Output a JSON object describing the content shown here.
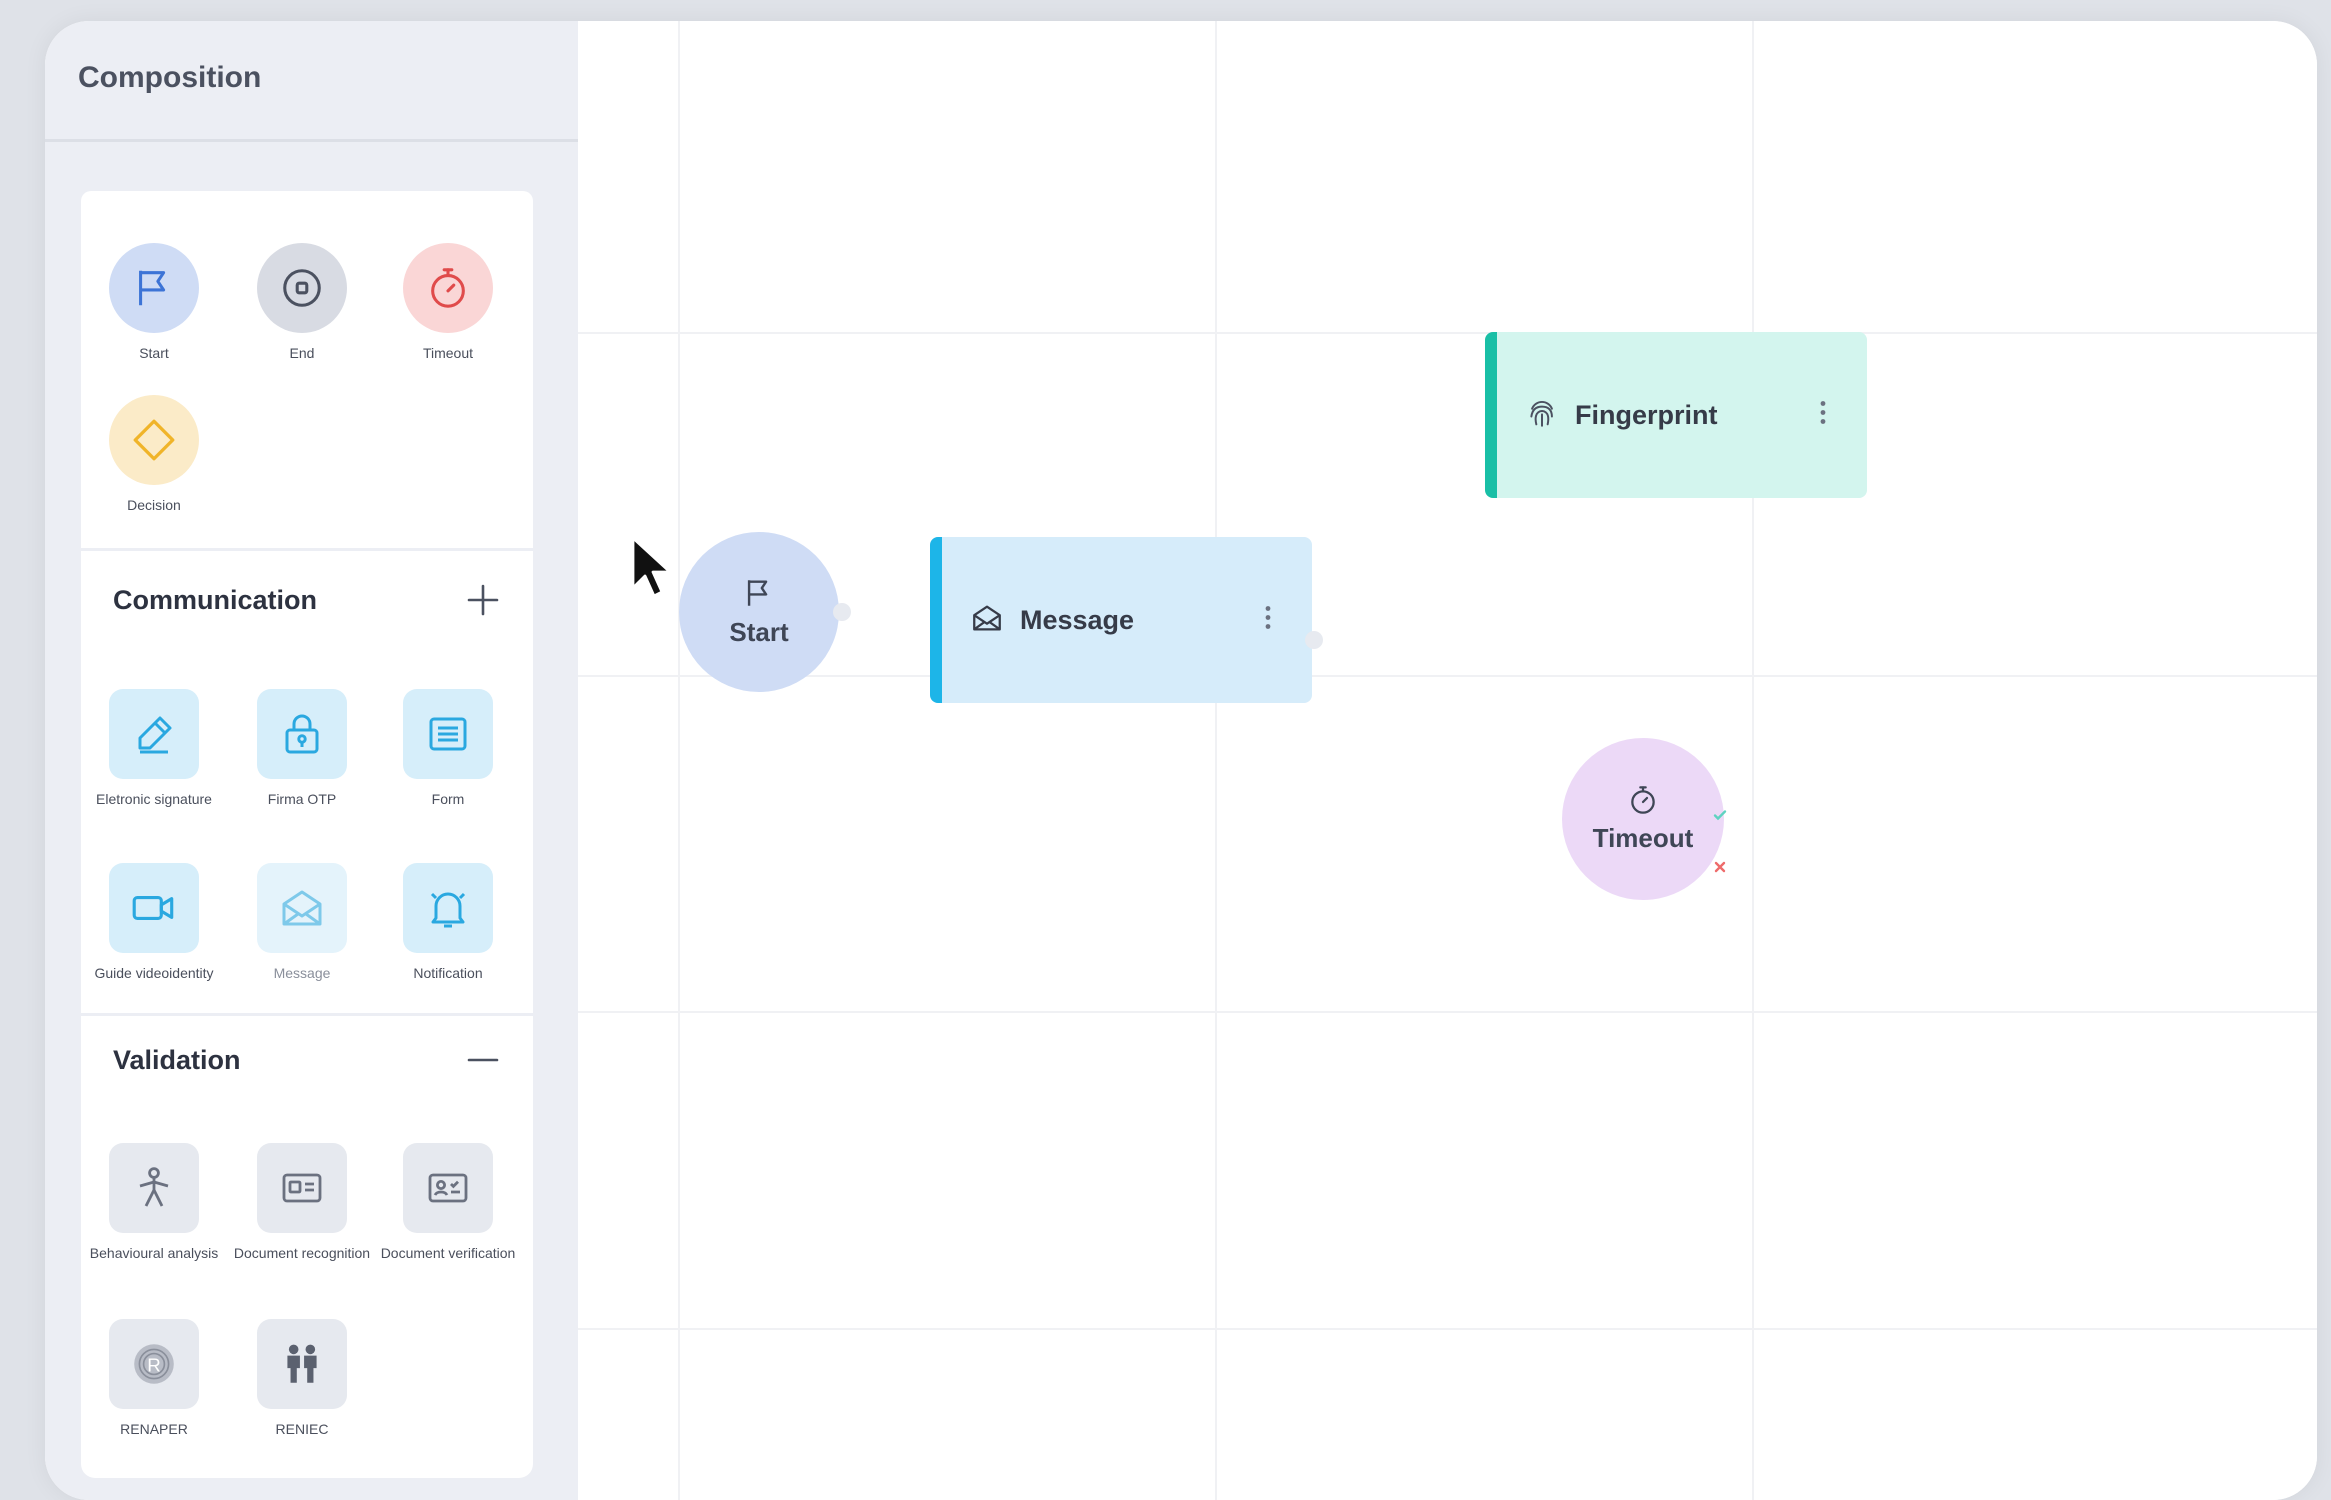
{
  "sidebar": {
    "title": "Composition",
    "basic_tools": [
      {
        "label": "Start",
        "icon": "flag-icon",
        "bg": "#cfdcf5"
      },
      {
        "label": "End",
        "icon": "stop-circle-icon",
        "bg": "#d8dbe3"
      },
      {
        "label": "Timeout",
        "icon": "stopwatch-icon",
        "bg": "#fad6d6"
      },
      {
        "label": "Decision",
        "icon": "diamond-icon",
        "bg": "#fbebc8"
      }
    ],
    "communication": {
      "title": "Communication",
      "toggle": "+",
      "items": [
        {
          "label": "Eletronic signature",
          "icon": "pen-icon"
        },
        {
          "label": "Firma OTP",
          "icon": "padlock-icon"
        },
        {
          "label": "Form",
          "icon": "form-icon"
        },
        {
          "label": "Guide videoidentity",
          "icon": "video-camera-icon"
        },
        {
          "label": "Message",
          "icon": "envelope-icon"
        },
        {
          "label": "Notification",
          "icon": "bell-icon"
        }
      ]
    },
    "validation": {
      "title": "Validation",
      "toggle": "—",
      "items": [
        {
          "label": "Behavioural analysis",
          "icon": "person-icon"
        },
        {
          "label": "Document recognition",
          "icon": "id-card-icon"
        },
        {
          "label": "Document verification",
          "icon": "id-card-check-icon"
        },
        {
          "label": "RENAPER",
          "icon": "fingerprint-badge-icon"
        },
        {
          "label": "RENIEC",
          "icon": "people-icon"
        }
      ]
    }
  },
  "canvas": {
    "nodes": {
      "start": {
        "label": "Start"
      },
      "message": {
        "label": "Message"
      },
      "fingerprint": {
        "label": "Fingerprint"
      },
      "timeout": {
        "label": "Timeout"
      }
    }
  },
  "colors": {
    "accent_message": "#1db5e8",
    "accent_fingerprint": "#19bfa6",
    "comm_tile": "#d6eefa",
    "validation_tile": "#e6e9ef"
  }
}
